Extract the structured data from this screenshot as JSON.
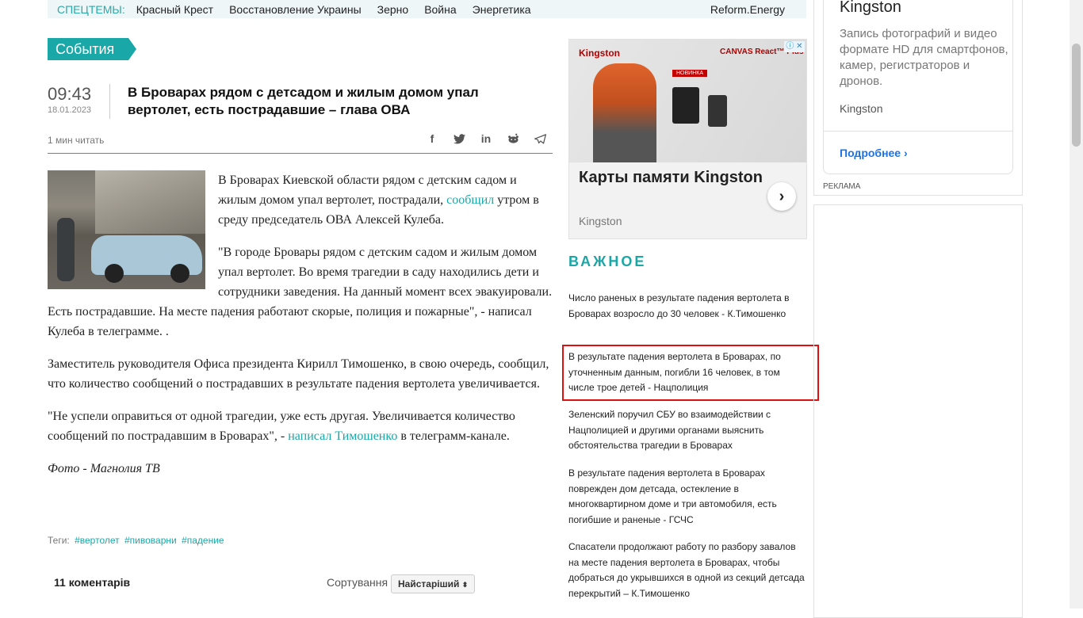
{
  "topbar": {
    "label": "СПЕЦТЕМЫ:",
    "items": [
      "Красный Крест",
      "Восстановление Украины",
      "Зерно",
      "Война",
      "Энергетика"
    ],
    "right": "Reform.Energy"
  },
  "section": "События",
  "article": {
    "time": "09:43",
    "date": "18.01.2023",
    "title": "В Броварах рядом с детсадом и жилым домом упал вертолет, есть пострадавшие – глава ОВА",
    "read_time": "1 мин читать",
    "p1_a": "В Броварах Киевской области рядом с детским садом и жилым домом упал вертолет, пострадали, ",
    "p1_link": "сообщил",
    "p1_b": " утром в среду председатель ОВА Алексей Кулеба.",
    "p2": "\"В городе Бровары рядом с детским садом и жилым домом упал вертолет. Во время трагедии в саду находились дети и сотрудники заведения. На данный момент всех эвакуировали. Есть пострадавшие. На месте падения работают скорые, полиция и пожарные\", - написал Кулеба в телеграмме. .",
    "p3": "Заместитель руководителя Офиса президента Кирилл Тимошенко, в свою очередь, сообщил, что количество сообщений о пострадавших в результате падения вертолета увеличивается.",
    "p4_a": "\"Не успели оправиться от одной трагедии, уже есть другая. Увеличивается количество сообщений по пострадавшим в Броварах\", - ",
    "p4_link": "написал Тимошенко",
    "p4_b": " в телеграмм-канале.",
    "credit": "Фото - Магнолия ТВ",
    "tags_label": "Теги:",
    "tags": [
      "#вертолет",
      "#пивоварни",
      "#падение"
    ]
  },
  "comments": {
    "count": "11 коментарів",
    "sort_label": "Сортування",
    "sort_value": "Найстаріший"
  },
  "ad": {
    "brand": "Kingston",
    "product": "CANVAS React™ Plus",
    "badge": "НОВИНКА",
    "headline": "Карты памяти Kingston",
    "sub": "Kingston"
  },
  "important": {
    "heading": "ВАЖНОЕ",
    "items": [
      "Число раненых в результате падения вертолета в Броварах возросло до 30 человек - К.Тимошенко",
      "В результате падения вертолета в Броварах, по уточненным данным, погибли 16 человек, в том числе трое детей - Нацполиция",
      "Зеленский поручил СБУ во взаимодействии с Нацполицией и другими органами выяснить обстоятельства трагедии в Броварах",
      "В результате падения вертолета в Броварах поврежден дом детсада, остекление в многоквартирном доме и три автомобиля, есть погибшие и раненые - ГСЧС",
      "Спасатели продолжают работу по разбору завалов на месте падения вертолета в Броварах, чтобы добраться до укрывшихся в одной из секций детсада перекрытий – К.Тимошенко"
    ]
  },
  "right_ad": {
    "title": "Kingston",
    "desc": "Запись фотографий и видео формате HD для смартфонов, камер, регистраторов и дронов.",
    "brand": "Kingston",
    "more": "Подробнее",
    "label": "РЕКЛАМА"
  },
  "colors": {
    "accent": "#1aa7a7",
    "highlight": "#e01010"
  }
}
